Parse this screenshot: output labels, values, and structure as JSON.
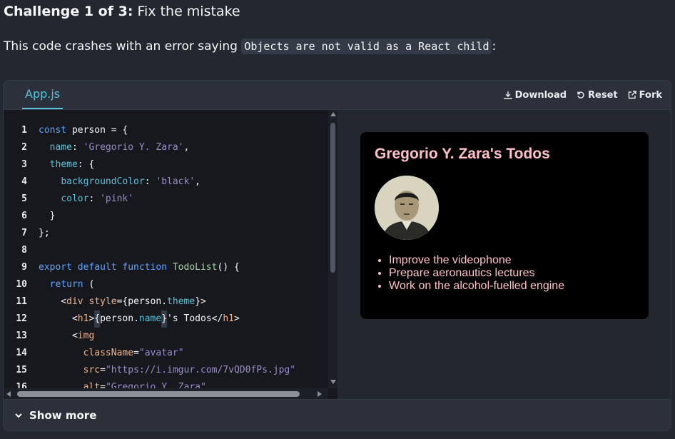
{
  "challenge": {
    "count_label": "Challenge 1 of 3:",
    "title": "Fix the mistake"
  },
  "description": {
    "text": "This code crashes with an error saying",
    "code": "Objects are not valid as a React child",
    "suffix": ":"
  },
  "sandbox": {
    "file_tab": "App.js",
    "actions": {
      "download": "Download",
      "reset": "Reset",
      "fork": "Fork"
    },
    "code_lines": [
      {
        "n": "1",
        "tokens": [
          [
            "kw",
            "const "
          ],
          [
            "plain",
            "person = {"
          ]
        ]
      },
      {
        "n": "2",
        "tokens": [
          [
            "plain",
            "  "
          ],
          [
            "prop",
            "name"
          ],
          [
            "plain",
            ": "
          ],
          [
            "str",
            "'Gregorio Y. Zara'"
          ],
          [
            "plain",
            ","
          ]
        ]
      },
      {
        "n": "3",
        "tokens": [
          [
            "plain",
            "  "
          ],
          [
            "prop",
            "theme"
          ],
          [
            "plain",
            ": {"
          ]
        ]
      },
      {
        "n": "4",
        "tokens": [
          [
            "plain",
            "    "
          ],
          [
            "prop",
            "backgroundColor"
          ],
          [
            "plain",
            ": "
          ],
          [
            "str",
            "'black'"
          ],
          [
            "plain",
            ","
          ]
        ]
      },
      {
        "n": "5",
        "tokens": [
          [
            "plain",
            "    "
          ],
          [
            "prop",
            "color"
          ],
          [
            "plain",
            ": "
          ],
          [
            "str",
            "'pink'"
          ]
        ]
      },
      {
        "n": "6",
        "tokens": [
          [
            "plain",
            "  }"
          ]
        ]
      },
      {
        "n": "7",
        "tokens": [
          [
            "plain",
            "};"
          ]
        ]
      },
      {
        "n": "8",
        "tokens": [
          [
            "plain",
            ""
          ]
        ]
      },
      {
        "n": "9",
        "tokens": [
          [
            "kw",
            "export default function "
          ],
          [
            "fn",
            "TodoList"
          ],
          [
            "plain",
            "() {"
          ]
        ]
      },
      {
        "n": "10",
        "tokens": [
          [
            "plain",
            "  "
          ],
          [
            "kw",
            "return"
          ],
          [
            "plain",
            " ("
          ]
        ]
      },
      {
        "n": "11",
        "tokens": [
          [
            "plain",
            "    <"
          ],
          [
            "tag",
            "div"
          ],
          [
            "plain",
            " "
          ],
          [
            "attr",
            "style"
          ],
          [
            "plain",
            "={person."
          ],
          [
            "prop",
            "theme"
          ],
          [
            "plain",
            "}>"
          ]
        ]
      },
      {
        "n": "12",
        "tokens": [
          [
            "plain",
            "      <"
          ],
          [
            "tag",
            "h1"
          ],
          [
            "plain",
            ">"
          ],
          [
            "brace",
            "{"
          ],
          [
            "plain",
            "person."
          ],
          [
            "prop",
            "name"
          ],
          [
            "brace",
            "}"
          ],
          [
            "plain",
            "'s Todos</"
          ],
          [
            "tag",
            "h1"
          ],
          [
            "plain",
            ">"
          ]
        ]
      },
      {
        "n": "13",
        "tokens": [
          [
            "plain",
            "      <"
          ],
          [
            "tag",
            "img"
          ]
        ]
      },
      {
        "n": "14",
        "tokens": [
          [
            "plain",
            "        "
          ],
          [
            "attr",
            "className"
          ],
          [
            "plain",
            "="
          ],
          [
            "str",
            "\"avatar\""
          ]
        ]
      },
      {
        "n": "15",
        "tokens": [
          [
            "plain",
            "        "
          ],
          [
            "attr",
            "src"
          ],
          [
            "plain",
            "="
          ],
          [
            "str",
            "\"https://i.imgur.com/7vQD0fPs.jpg\""
          ]
        ]
      },
      {
        "n": "16",
        "tokens": [
          [
            "plain",
            "        "
          ],
          [
            "attr",
            "alt"
          ],
          [
            "plain",
            "="
          ],
          [
            "str",
            "\"Gregorio Y. Zara\""
          ]
        ]
      }
    ],
    "preview": {
      "heading": "Gregorio Y. Zara's Todos",
      "items": [
        "Improve the videophone",
        "Prepare aeronautics lectures",
        "Work on the alcohol-fuelled engine"
      ]
    },
    "show_more": "Show more"
  },
  "colors": {
    "accent": "#58c4dc",
    "card_bg": "#000000",
    "card_text": "pink"
  }
}
